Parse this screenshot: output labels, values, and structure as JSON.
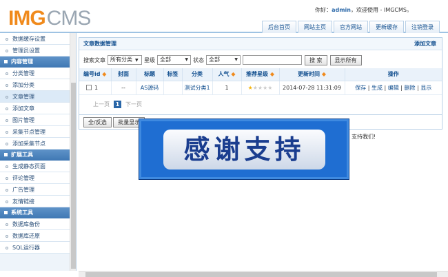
{
  "header": {
    "logo_img": "IMG",
    "logo_cms": "CMS",
    "welcome_prefix": "你好：",
    "user": "admin",
    "welcome_suffix": "，欢迎使用 - IMGCMS。",
    "nav": [
      "后台首页",
      "网站主页",
      "官方网站",
      "更新缓存",
      "注销登录"
    ]
  },
  "sidebar": {
    "groups": [
      {
        "title": null,
        "items": [
          "数据缓存设置",
          "管理员设置"
        ]
      },
      {
        "title": "内容管理",
        "items": [
          "分类管理",
          "添加分类",
          "文章管理",
          "添加文章",
          "图片管理",
          "采集节点管理",
          "添加采集节点"
        ]
      },
      {
        "title": "扩展工具",
        "items": [
          "生成静态页面",
          "评论管理",
          "广告管理",
          "友情链接"
        ]
      },
      {
        "title": "系统工具",
        "items": [
          "数据库备份",
          "数据库还原",
          "SQL运行器"
        ]
      }
    ],
    "selected": "文章管理"
  },
  "panel": {
    "title": "文章数据管理",
    "add_link": "添加文章",
    "search": {
      "label": "搜索文章",
      "category": "所有分类",
      "star_label": "星级",
      "star_value": "全部",
      "status_label": "状态",
      "status_value": "全部",
      "input_value": "",
      "search_button": "搜 索",
      "show_all_button": "显示所有"
    },
    "columns": [
      "编号id",
      "封面",
      "标题",
      "标签",
      "分类",
      "人气",
      "推荐星级",
      "更新时间",
      "操作"
    ],
    "rows": [
      {
        "id": "1",
        "cover": "--",
        "title": "AS源码",
        "tag": "",
        "category": "测试分类1",
        "views": "1",
        "stars": 1,
        "stars_max": 5,
        "time": "2014-07-28 11:31:09",
        "actions": [
          "保存",
          "生成",
          "编辑",
          "删除",
          "显示"
        ]
      }
    ],
    "pager": {
      "prev": "上一页",
      "current": "1",
      "next": "下一页"
    },
    "bottom": {
      "select_all": "全/反选",
      "batch": "批量显示"
    },
    "footnote": "支持我们!"
  },
  "overlay": {
    "text": "感谢支持"
  },
  "colors": {
    "accent": "#3f78b4",
    "logo_orange": "#f08a1c",
    "overlay_blue": "#1f6ed2"
  }
}
